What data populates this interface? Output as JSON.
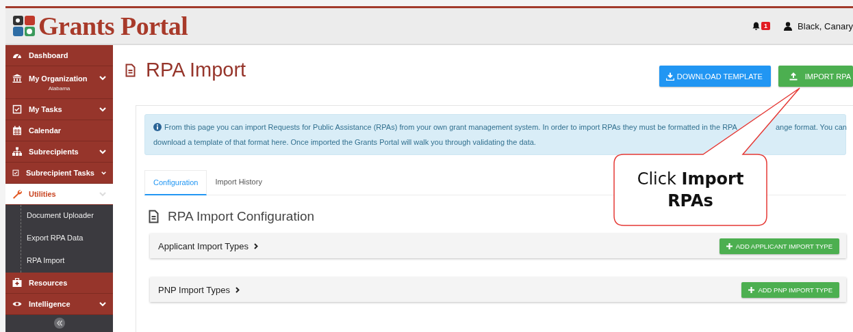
{
  "header": {
    "logo_text": "Grants Portal",
    "notifications": {
      "count": "1"
    },
    "user": {
      "name": "Black, Canary"
    }
  },
  "sidebar": {
    "items": [
      {
        "label": "Dashboard",
        "has_submenu": false,
        "selected": false
      },
      {
        "label": "My Organization",
        "subtitle": "Alabama",
        "has_submenu": true,
        "selected": false
      },
      {
        "label": "My Tasks",
        "has_submenu": true,
        "selected": false
      },
      {
        "label": "Calendar",
        "has_submenu": false,
        "selected": false
      },
      {
        "label": "Subrecipients",
        "has_submenu": true,
        "selected": false
      },
      {
        "label": "Subrecipient Tasks",
        "has_submenu": true,
        "selected": false
      },
      {
        "label": "Utilities",
        "has_submenu": true,
        "selected": true,
        "children": [
          {
            "label": "Document Uploader"
          },
          {
            "label": "Export RPA Data"
          },
          {
            "label": "RPA Import"
          }
        ]
      },
      {
        "label": "Resources",
        "has_submenu": false,
        "selected": false
      },
      {
        "label": "Intelligence",
        "has_submenu": true,
        "selected": false
      }
    ]
  },
  "page": {
    "title": "RPA Import",
    "buttons": [
      {
        "label": "DOWNLOAD TEMPLATE",
        "kind": "download"
      },
      {
        "label": "IMPORT RPA",
        "kind": "import"
      }
    ],
    "info": {
      "line_1_start": "From this page you can import Requests for Public Assistance (RPAs) from your own grant management system. In order to import RPAs they must be formatted in the RPA",
      "line_1_end": "ange format. You can",
      "line_2": "download a template of that format here. Once imported the Grants Portal will walk you through validating the data."
    },
    "tabs": [
      {
        "label": "Configuration",
        "selected": true
      },
      {
        "label": "Import History",
        "selected": false
      }
    ],
    "section_title": "RPA Import Configuration",
    "panels": [
      {
        "title": "Applicant Import Types",
        "button": "ADD APPLICANT IMPORT TYPE"
      },
      {
        "title": "PNP Import Types",
        "button": "ADD PNP IMPORT TYPE"
      }
    ]
  },
  "callout": {
    "text": "Click **Import RPAs**"
  }
}
